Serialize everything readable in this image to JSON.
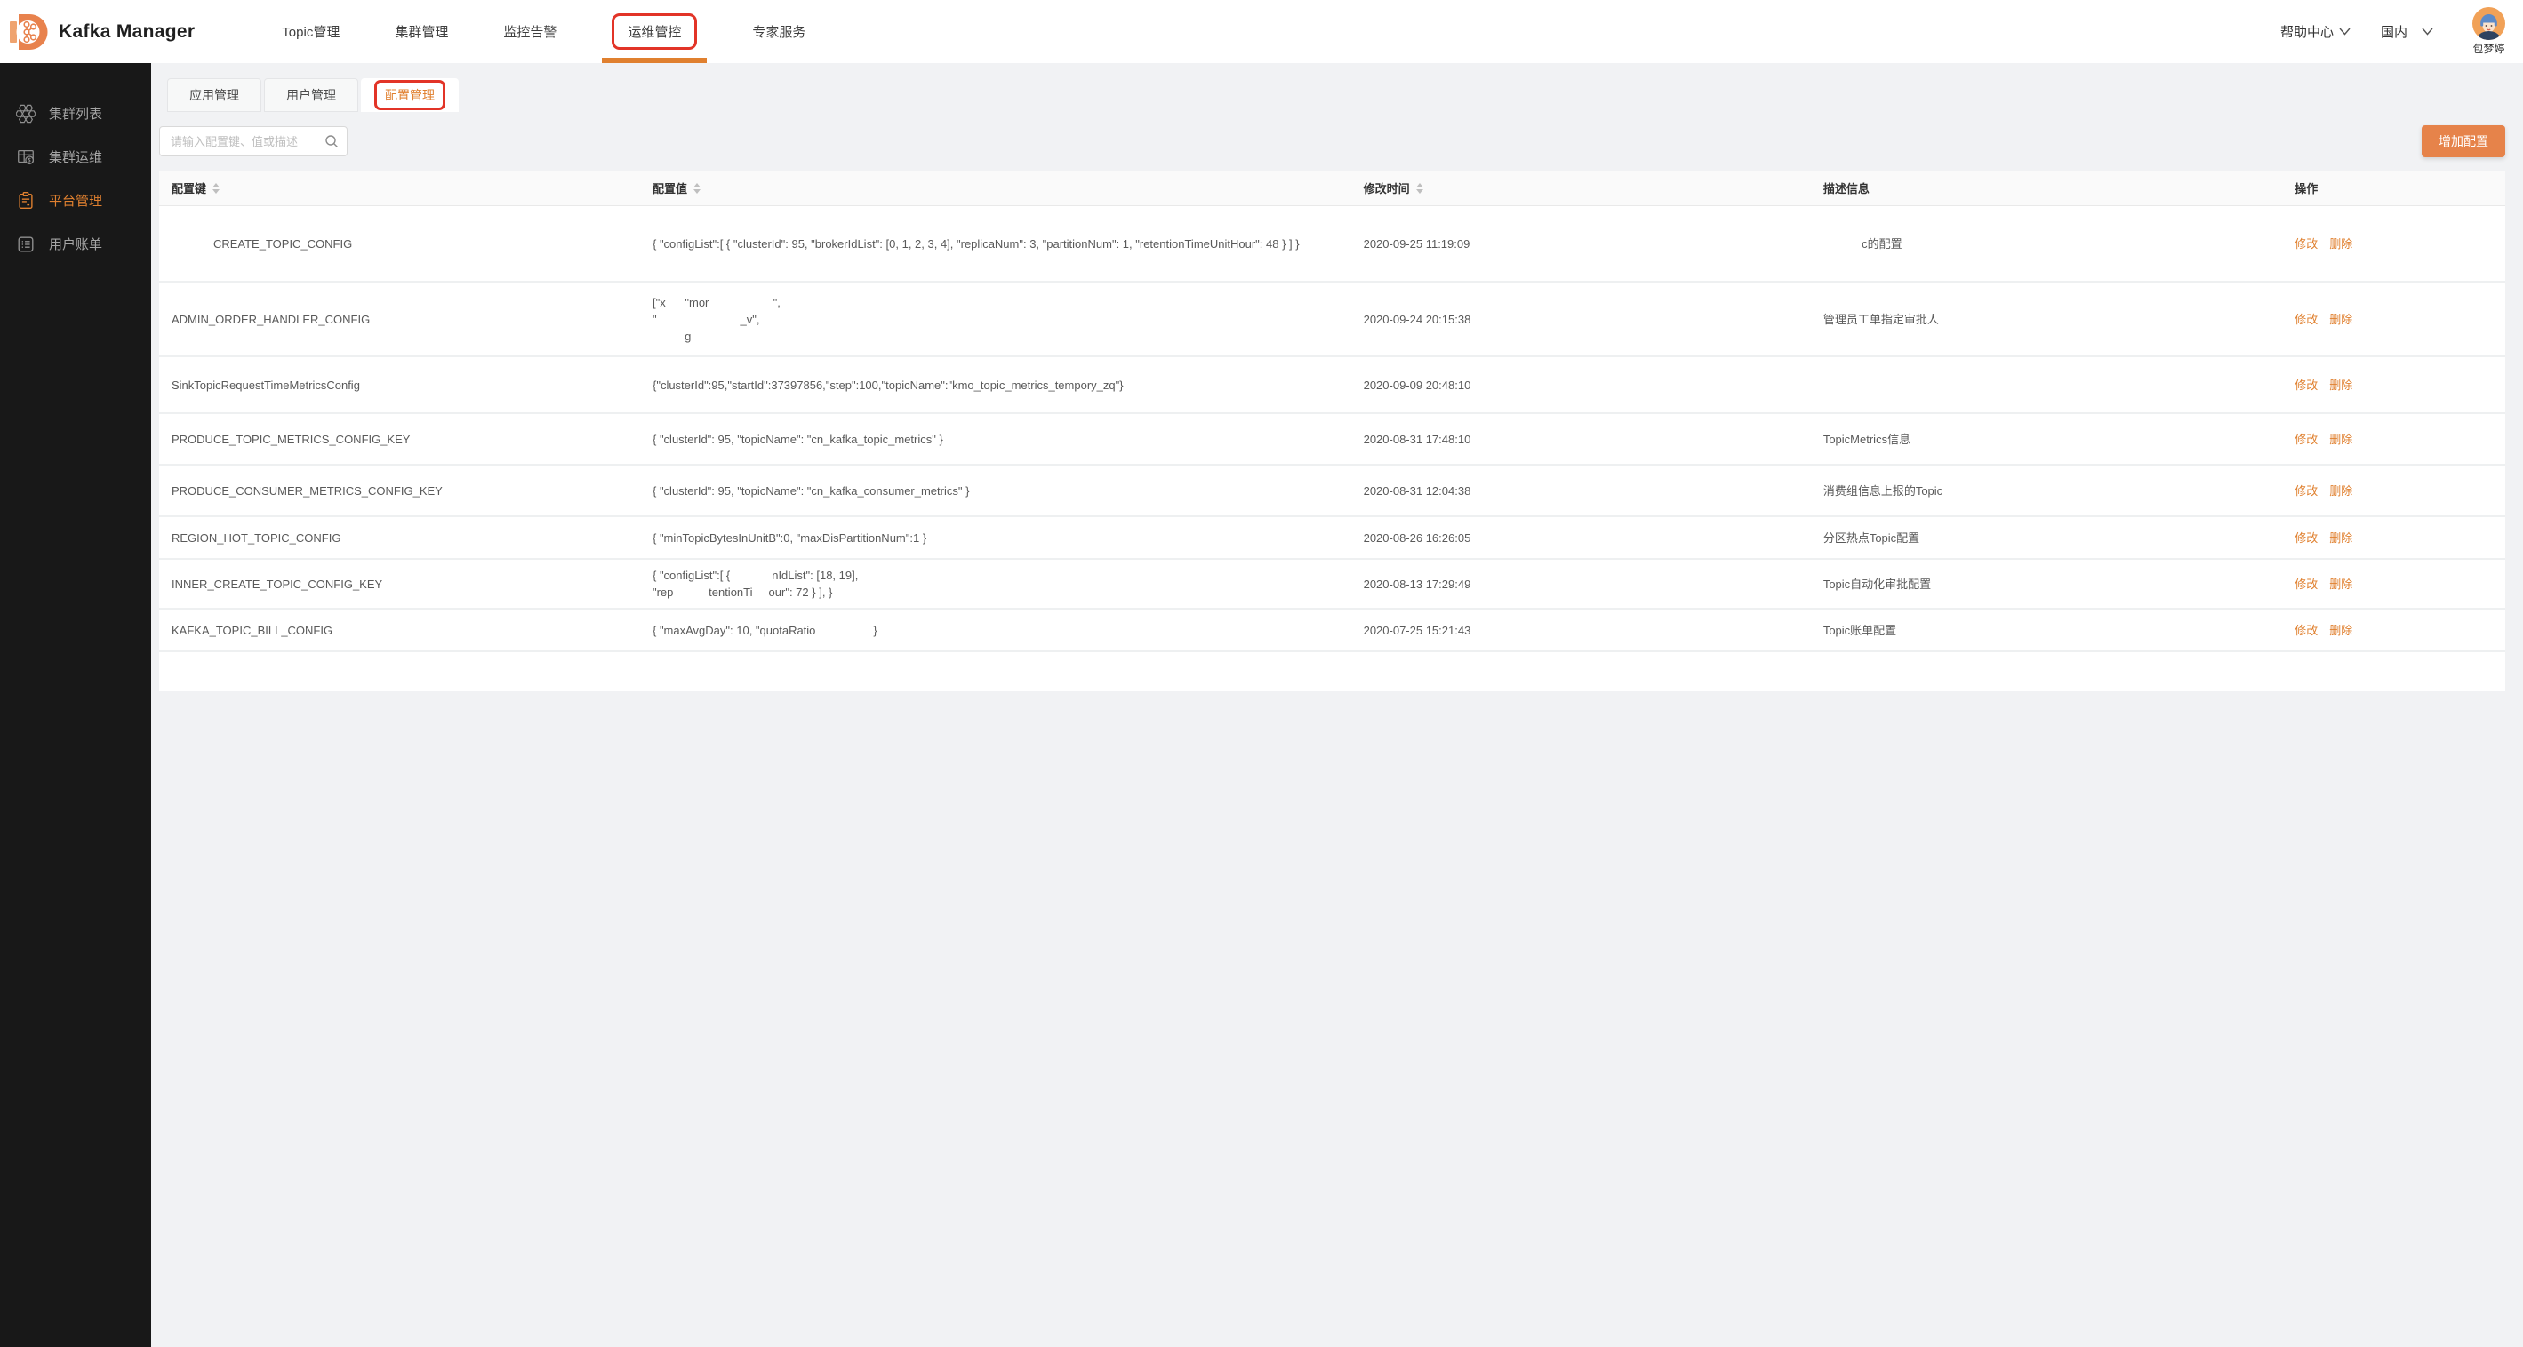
{
  "header": {
    "title": "Kafka Manager",
    "nav": [
      {
        "label": "Topic管理",
        "active": false
      },
      {
        "label": "集群管理",
        "active": false
      },
      {
        "label": "监控告警",
        "active": false
      },
      {
        "label": "运维管控",
        "active": true,
        "annotated": true
      },
      {
        "label": "专家服务",
        "active": false
      }
    ],
    "help_label": "帮助中心",
    "region_label": "国内",
    "username": "包梦婷"
  },
  "sidebar": {
    "items": [
      {
        "label": "集群列表",
        "icon": "cluster-list-icon",
        "active": false
      },
      {
        "label": "集群运维",
        "icon": "cluster-ops-icon",
        "active": false
      },
      {
        "label": "平台管理",
        "icon": "platform-manage-icon",
        "active": true
      },
      {
        "label": "用户账单",
        "icon": "user-bill-icon",
        "active": false
      }
    ]
  },
  "tabs": [
    {
      "label": "应用管理",
      "active": false
    },
    {
      "label": "用户管理",
      "active": false
    },
    {
      "label": "配置管理",
      "active": true,
      "annotated": true
    }
  ],
  "toolbar": {
    "search_placeholder": "请输入配置键、值或描述",
    "add_button": "增加配置"
  },
  "colors": {
    "accent_orange": "#e0802f",
    "button_orange": "#e6834a",
    "annotation_red": "#e23427",
    "sidebar_bg": "#181818"
  },
  "table": {
    "columns": [
      {
        "label": "配置键",
        "sortable": true
      },
      {
        "label": "配置值",
        "sortable": true
      },
      {
        "label": "修改时间",
        "sortable": true
      },
      {
        "label": "描述信息",
        "sortable": false
      },
      {
        "label": "操作",
        "sortable": false
      }
    ],
    "actions": {
      "edit": "修改",
      "delete": "删除"
    },
    "rows": [
      {
        "key": "             CREATE_TOPIC_CONFIG",
        "value": "{ \"configList\":[ { \"clusterId\": 95, \"brokerIdList\": [0, 1, 2, 3, 4], \"replicaNum\": 3, \"partitionNum\": 1, \"retentionTimeUnitHour\": 48 } ] }",
        "time": "2020-09-25 11:19:09",
        "desc": "            c的配置"
      },
      {
        "key": "ADMIN_ORDER_HANDLER_CONFIG",
        "value": "[\"x      \"mor                    \",\n\"                          _v\",\n          g",
        "time": "2020-09-24 20:15:38",
        "desc": "管理员工单指定审批人"
      },
      {
        "key": "SinkTopicRequestTimeMetricsConfig",
        "value": "{\"clusterId\":95,\"startId\":37397856,\"step\":100,\"topicName\":\"kmo_topic_metrics_tempory_zq\"}",
        "time": "2020-09-09 20:48:10",
        "desc": ""
      },
      {
        "key": "PRODUCE_TOPIC_METRICS_CONFIG_KEY",
        "value": "{ \"clusterId\": 95, \"topicName\": \"cn_kafka_topic_metrics\" }",
        "time": "2020-08-31 17:48:10",
        "desc": "TopicMetrics信息"
      },
      {
        "key": "PRODUCE_CONSUMER_METRICS_CONFIG_KEY",
        "value": "{ \"clusterId\": 95, \"topicName\": \"cn_kafka_consumer_metrics\" }",
        "time": "2020-08-31 12:04:38",
        "desc": "消费组信息上报的Topic"
      },
      {
        "key": "REGION_HOT_TOPIC_CONFIG",
        "value": "{ \"minTopicBytesInUnitB\":0, \"maxDisPartitionNum\":1 }",
        "time": "2020-08-26 16:26:05",
        "desc": "分区热点Topic配置"
      },
      {
        "key": "INNER_CREATE_TOPIC_CONFIG_KEY",
        "value": "{ \"configList\":[ {             nIdList\": [18, 19],\n\"rep           tentionTi     our\": 72 } ], }",
        "time": "2020-08-13 17:29:49",
        "desc": "Topic自动化审批配置"
      },
      {
        "key": "KAFKA_TOPIC_BILL_CONFIG",
        "value": "{ \"maxAvgDay\": 10, \"quotaRatio                  }",
        "time": "2020-07-25 15:21:43",
        "desc": "Topic账单配置"
      }
    ]
  }
}
